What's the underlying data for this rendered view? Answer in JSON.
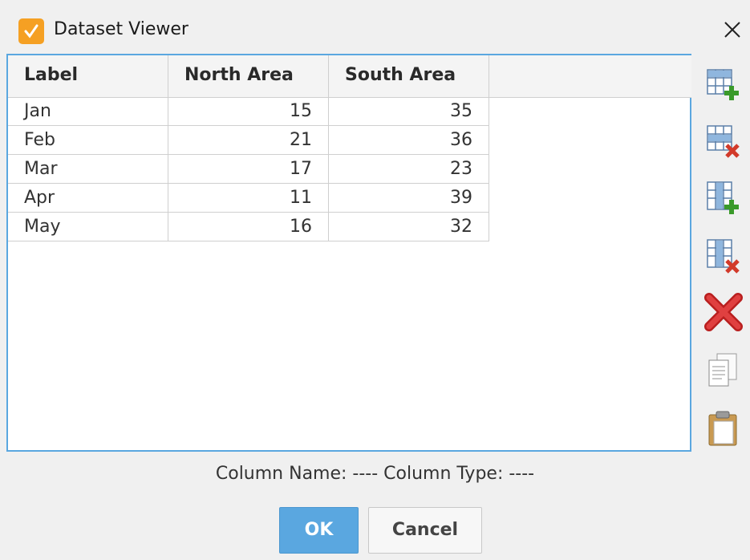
{
  "window": {
    "title": "Dataset Viewer",
    "close_icon": "close-icon"
  },
  "table": {
    "columns": [
      "Label",
      "North Area",
      "South Area"
    ],
    "rows": [
      [
        "Jan",
        "15",
        "35"
      ],
      [
        "Feb",
        "21",
        "36"
      ],
      [
        "Mar",
        "17",
        "23"
      ],
      [
        "Apr",
        "11",
        "39"
      ],
      [
        "May",
        "16",
        "32"
      ]
    ]
  },
  "toolbar": {
    "icons": [
      "add-row-icon",
      "delete-row-icon",
      "add-column-icon",
      "delete-column-icon",
      "clear-icon",
      "copy-icon",
      "paste-icon"
    ]
  },
  "status": {
    "text": "Column Name: ----  Column Type: ----"
  },
  "buttons": {
    "ok": "OK",
    "cancel": "Cancel"
  },
  "colors": {
    "accent": "#5aa7e0",
    "app_icon": "#f5a023",
    "add": "#3a9a2a",
    "delete": "#d23a2a"
  }
}
